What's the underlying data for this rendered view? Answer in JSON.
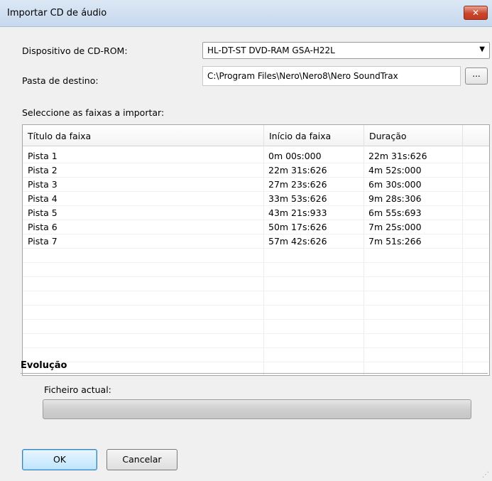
{
  "window": {
    "title": "Importar CD de áudio",
    "close_glyph": "✕"
  },
  "form": {
    "cdrom_label": "Dispositivo de CD-ROM:",
    "cdrom_value": "HL-DT-ST DVD-RAM GSA-H22L",
    "dest_label": "Pasta de destino:",
    "dest_value": "C:\\Program Files\\Nero\\Nero8\\Nero SoundTrax",
    "browse_label": "...",
    "tracks_label": "Seleccione as faixas a importar:"
  },
  "tracks": {
    "columns": [
      "Título da faixa",
      "Início da faixa",
      "Duração"
    ],
    "rows": [
      {
        "title": "Pista 1",
        "start": "0m 00s:000",
        "duration": "22m 31s:626"
      },
      {
        "title": "Pista 2",
        "start": "22m 31s:626",
        "duration": "4m 52s:000"
      },
      {
        "title": "Pista 3",
        "start": "27m 23s:626",
        "duration": "6m 30s:000"
      },
      {
        "title": "Pista 4",
        "start": "33m 53s:626",
        "duration": "9m 28s:306"
      },
      {
        "title": "Pista 5",
        "start": "43m 21s:933",
        "duration": "6m 55s:693"
      },
      {
        "title": "Pista 6",
        "start": "50m 17s:626",
        "duration": "7m 25s:000"
      },
      {
        "title": "Pista 7",
        "start": "57m 42s:626",
        "duration": "7m 51s:266"
      }
    ]
  },
  "progress": {
    "section_title": "Evolução",
    "current_file_label": "Ficheiro actual:",
    "value": 0
  },
  "buttons": {
    "ok_label": "OK",
    "cancel_label": "Cancelar"
  }
}
